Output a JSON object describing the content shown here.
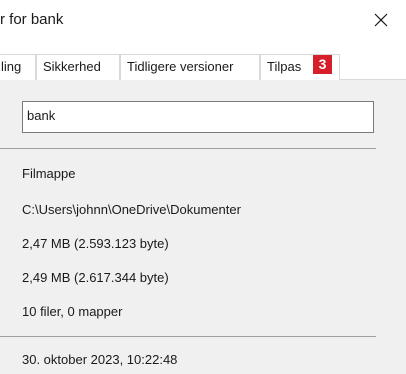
{
  "window": {
    "title": "r for bank",
    "close_icon": "close-icon"
  },
  "tabs": [
    {
      "label": "ling"
    },
    {
      "label": "Sikkerhed"
    },
    {
      "label": "Tidligere versioner"
    },
    {
      "label": "Tilpas"
    }
  ],
  "badge": "3",
  "general": {
    "name_value": "bank",
    "type": "Filmappe",
    "location": "C:\\Users\\johnn\\OneDrive\\Dokumenter",
    "size": "2,47 MB (2.593.123 byte)",
    "size_on_disk": "2,49 MB (2.617.344 byte)",
    "contains": "10 filer, 0 mapper",
    "created": "30. oktober 2023, 10:22:48"
  },
  "colors": {
    "badge": "#d61f2a",
    "panel_bg": "#f0f0f0"
  }
}
